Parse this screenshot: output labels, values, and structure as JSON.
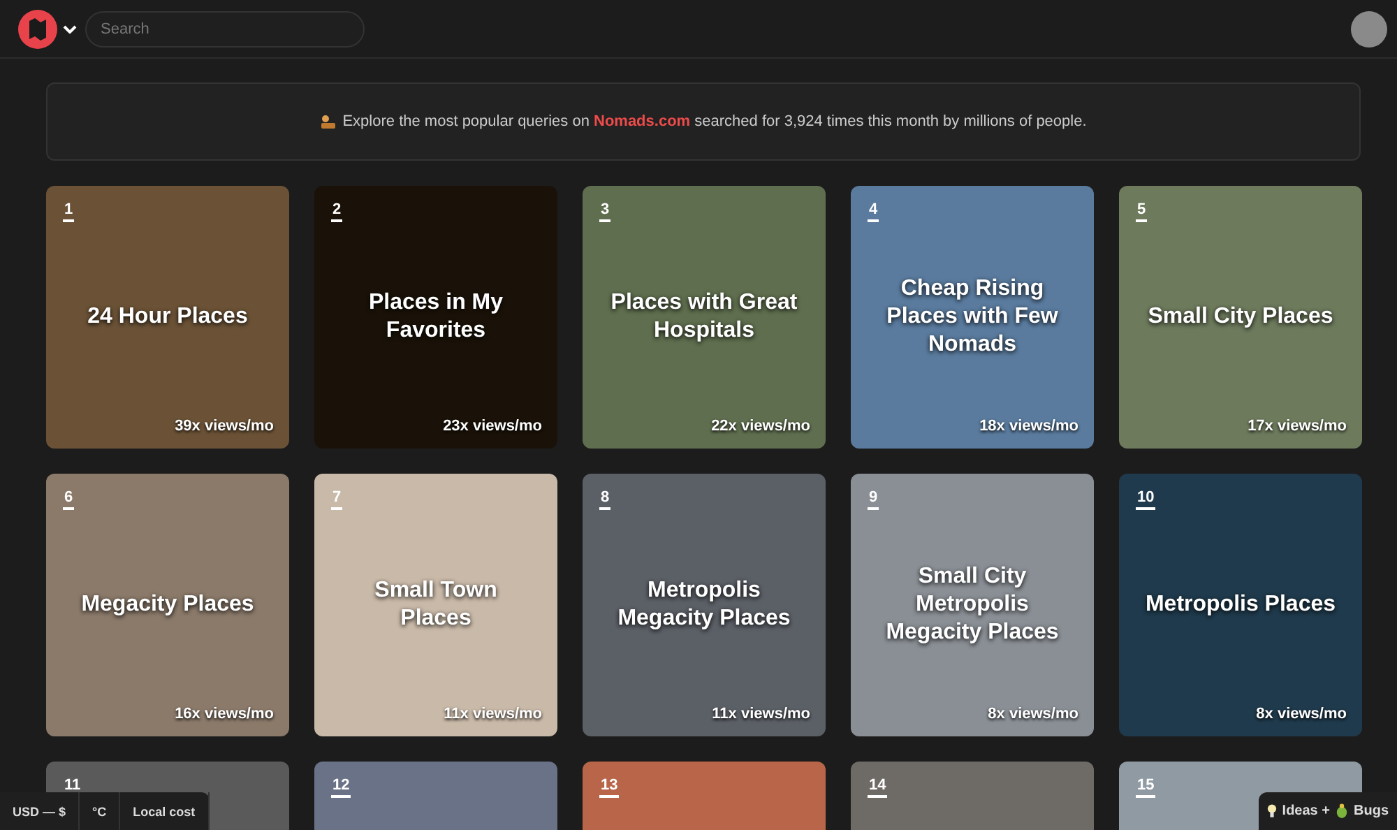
{
  "header": {
    "search": {
      "placeholder": "Search"
    }
  },
  "banner": {
    "text": "Explore the most popular queries on **Nomads.com** searched for 3,924 times this month by millions of people."
  },
  "cards": [
    {
      "rank": "1",
      "title": "24 Hour Places",
      "views": "39x views/mo"
    },
    {
      "rank": "2",
      "title": "Places in My Favorites",
      "views": "23x views/mo"
    },
    {
      "rank": "3",
      "title": "Places with Great Hospitals",
      "views": "22x views/mo"
    },
    {
      "rank": "4",
      "title": "Cheap Rising Places with Few Nomads",
      "views": "18x views/mo"
    },
    {
      "rank": "5",
      "title": "Small City Places",
      "views": "17x views/mo"
    },
    {
      "rank": "6",
      "title": "Megacity Places",
      "views": "16x views/mo"
    },
    {
      "rank": "7",
      "title": "Small Town Places",
      "views": "11x views/mo"
    },
    {
      "rank": "8",
      "title": "Metropolis Megacity Places",
      "views": "11x views/mo"
    },
    {
      "rank": "9",
      "title": "Small City Metropolis Megacity Places",
      "views": "8x views/mo"
    },
    {
      "rank": "10",
      "title": "Metropolis Places",
      "views": "8x views/mo"
    },
    {
      "rank": "11"
    },
    {
      "rank": "12"
    },
    {
      "rank": "13"
    },
    {
      "rank": "14"
    },
    {
      "rank": "15"
    }
  ],
  "bottom_left": [
    "USD — $",
    "°C",
    "Local cost"
  ],
  "bottom_right": {
    "ideas": "Ideas +",
    "bugs": "Bugs"
  }
}
